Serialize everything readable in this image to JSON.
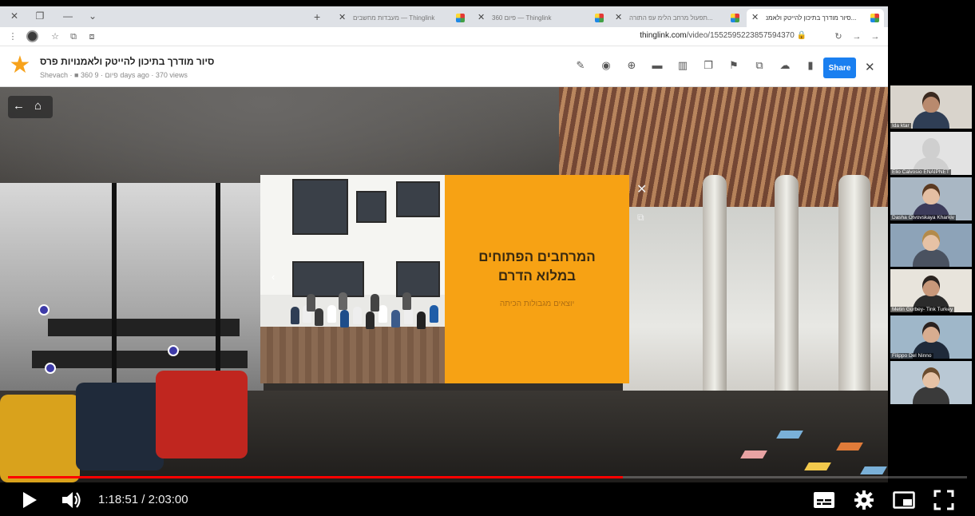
{
  "browser": {
    "tabs": [
      {
        "title": "סיור מודרך בתיכון להייטק ולאמנ...",
        "active": true
      },
      {
        "title": "תפעול מרחב הלימ עפ התורה...",
        "active": false
      },
      {
        "title": "360 פיום — Thinglink",
        "active": false
      },
      {
        "title": "מעבדות מחשבים — Thinglink",
        "active": false
      }
    ],
    "url_host": "thinglink.com",
    "url_path": "/video/1552595223857594370"
  },
  "thinglink": {
    "title": "סיור מודרך בתיכון להייטק ולאמנויות פרס",
    "owner": "Shevach",
    "folder": "360 פיום",
    "date": "9 days ago",
    "views": "370 views",
    "share_label": "Share"
  },
  "popup": {
    "title_line1": "המרחבים הפתוחים",
    "title_line2": "במלוא הדרם",
    "subtitle": "יוצאים מגבולות הכיתה"
  },
  "participants": [
    {
      "name": "Ida ktar",
      "bg": "#d9d4cc",
      "skin": "#b98a6e",
      "shirt": "#2f3e55",
      "hair": "#3a2a20"
    },
    {
      "name": "Elio Calvosio ENAIPNET",
      "bg": "#e3e3e3",
      "skin": "#cfcfcf",
      "shirt": "#cfcfcf",
      "hair": "#cfcfcf"
    },
    {
      "name": "Dasha Otvovskaya Kharkiv",
      "bg": "#a9b7c4",
      "skin": "#e4bfa3",
      "shirt": "#3c3b5a",
      "hair": "#5a3a22"
    },
    {
      "name": "",
      "bg": "#8da3b8",
      "skin": "#e6c2a5",
      "shirt": "#4a5260",
      "hair": "#b38a4a"
    },
    {
      "name": "Metin Gürbey- Tink Turkey",
      "bg": "#e8e4dc",
      "skin": "#c8987a",
      "shirt": "#2b2b2b",
      "hair": "#2a2320"
    },
    {
      "name": "Filippo Del Ninno",
      "bg": "#9fb7c9",
      "skin": "#d8ad90",
      "shirt": "#1f2a3a",
      "hair": "#2a2220"
    },
    {
      "name": "",
      "bg": "#b9c8d4",
      "skin": "#e6c2a5",
      "shirt": "#3a3a3a",
      "hair": "#6b4c2e"
    }
  ],
  "player": {
    "current_time": "1:18:51",
    "duration": "2:03:00",
    "progress_fraction": 0.641,
    "accent": "#ff0000"
  },
  "icons": {
    "play": "play-icon",
    "volume": "volume-icon",
    "subtitles": "subtitles-icon",
    "settings": "gear-icon",
    "miniplayer": "miniplayer-icon",
    "fullscreen": "fullscreen-icon"
  }
}
